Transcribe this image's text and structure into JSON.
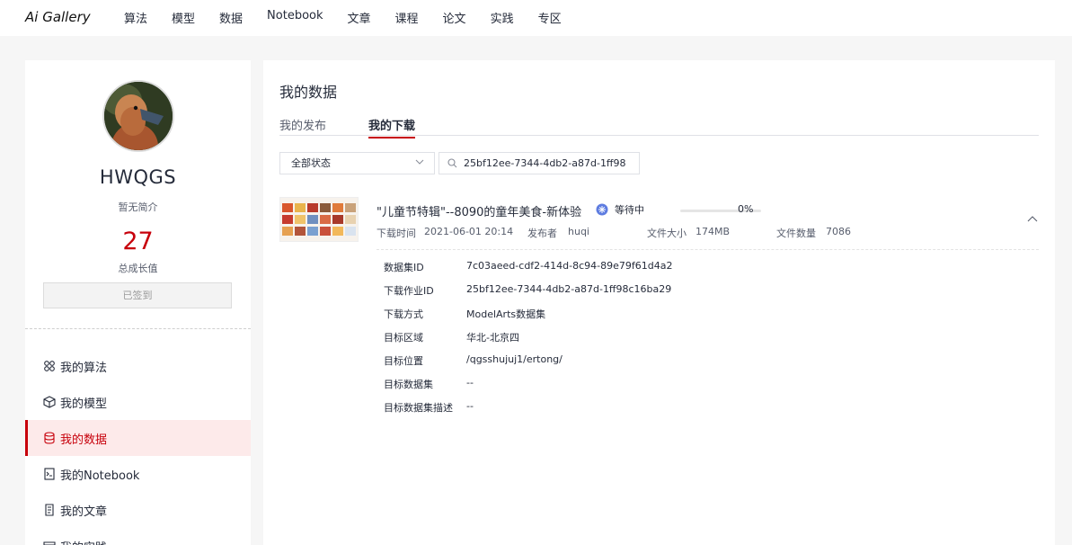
{
  "header": {
    "logo": "Ai Gallery",
    "nav": [
      "算法",
      "模型",
      "数据",
      "Notebook",
      "文章",
      "课程",
      "论文",
      "实践",
      "专区"
    ]
  },
  "profile": {
    "username": "HWQGS",
    "intro": "暂无简介",
    "growth_value": "27",
    "growth_label": "总成长值",
    "checkin_label": "已签到"
  },
  "sidebar": {
    "items": [
      {
        "label": "我的算法",
        "icon": "algorithm-icon"
      },
      {
        "label": "我的模型",
        "icon": "cube-icon"
      },
      {
        "label": "我的数据",
        "icon": "database-icon",
        "active": true
      },
      {
        "label": "我的Notebook",
        "icon": "notebook-icon"
      },
      {
        "label": "我的文章",
        "icon": "article-icon"
      },
      {
        "label": "我的实践",
        "icon": "practice-icon"
      }
    ]
  },
  "main": {
    "title": "我的数据",
    "tabs": [
      {
        "label": "我的发布",
        "active": false
      },
      {
        "label": "我的下载",
        "active": true
      }
    ],
    "filter": {
      "status_selected": "全部状态",
      "search_value": "25bf12ee-7344-4db2-a87d-1ff98"
    },
    "dataset": {
      "title": "\"儿童节特辑\"--8090的童年美食-新体验",
      "status": "等待中",
      "progress_text": "0%",
      "progress_value": 0,
      "download_time_label": "下载时间",
      "download_time": "2021-06-01 20:14",
      "publisher_label": "发布者",
      "publisher": "huqi",
      "file_size_label": "文件大小",
      "file_size": "174MB",
      "file_count_label": "文件数量",
      "file_count": "7086",
      "details": [
        {
          "label": "数据集ID",
          "value": "7c03aeed-cdf2-414d-8c94-89e79f61d4a2"
        },
        {
          "label": "下载作业ID",
          "value": "25bf12ee-7344-4db2-a87d-1ff98c16ba29"
        },
        {
          "label": "下载方式",
          "value": "ModelArts数据集"
        },
        {
          "label": "目标区域",
          "value": "华北-北京四"
        },
        {
          "label": "目标位置",
          "value": "/qgsshujuj1/ertong/"
        },
        {
          "label": "目标数据集",
          "value": "--"
        },
        {
          "label": "目标数据集描述",
          "value": "--"
        }
      ]
    }
  },
  "colors": {
    "accent": "#c7000b",
    "active_bg": "#fdeaea",
    "progress": "#5e7ce0"
  }
}
